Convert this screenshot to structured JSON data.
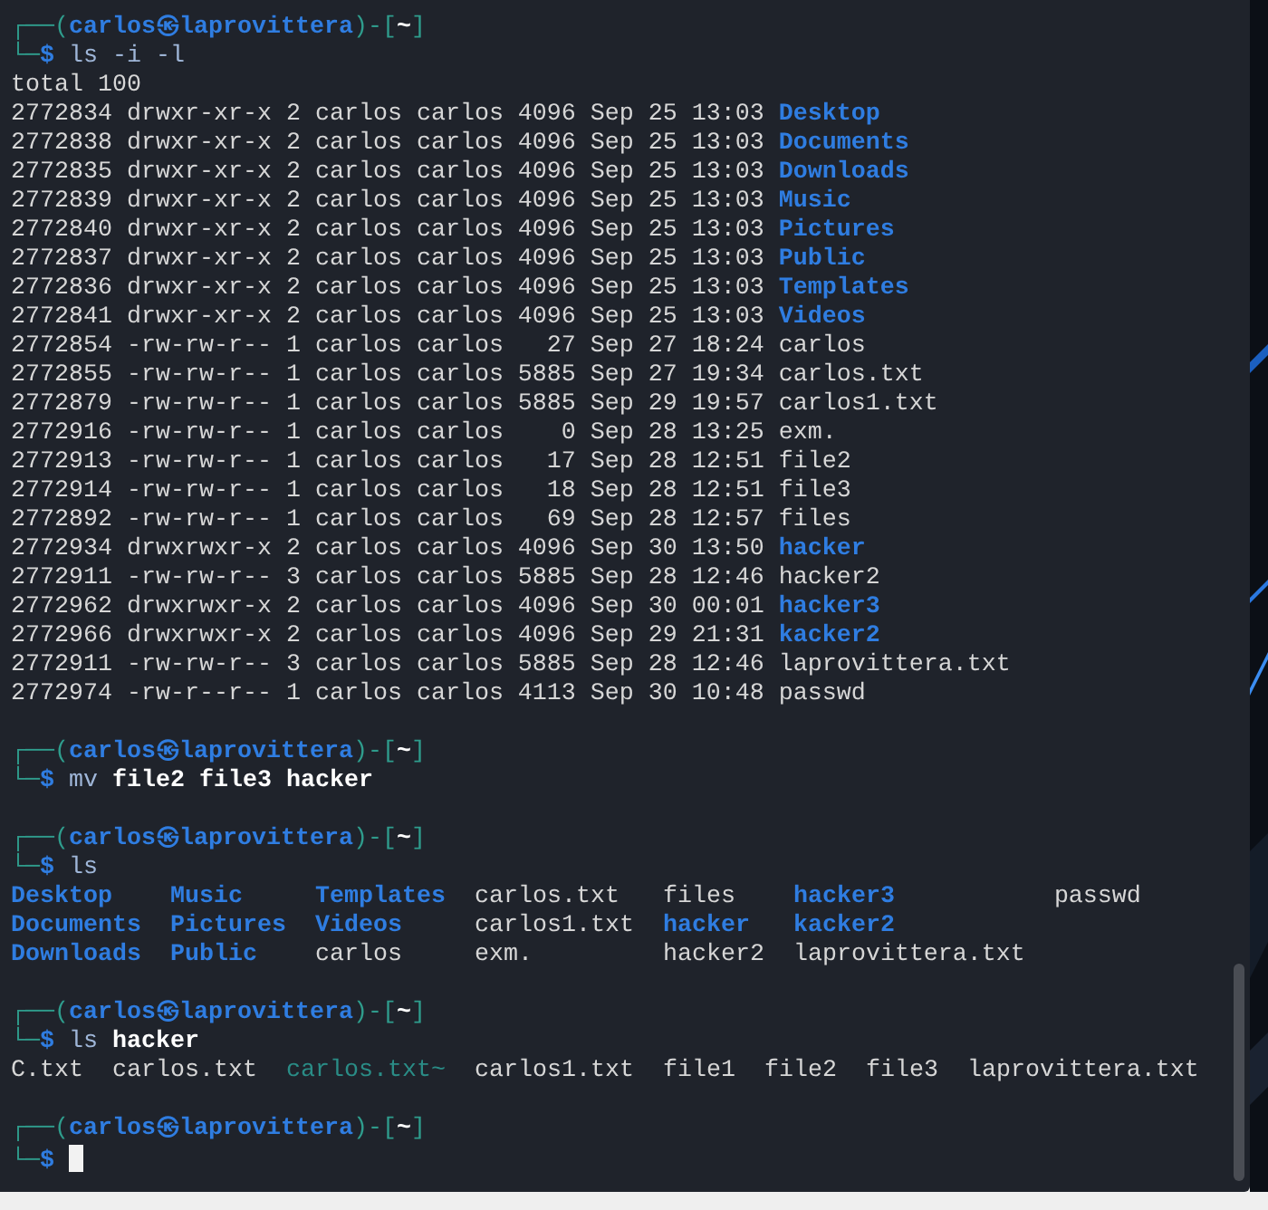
{
  "terminal": {
    "blocks": [
      {
        "prompt": {
          "open": "┌──(",
          "user_host": "carlos㉿laprovittera",
          "mid": ")-[",
          "dir": "~",
          "close": "]",
          "corner": "└─",
          "sign": "$"
        },
        "command": {
          "name": "ls",
          "args": "-i -l",
          "args_bold": false
        },
        "output": {
          "kind": "long_listing",
          "header": "total 100",
          "rows": [
            {
              "inode": "2772834",
              "perms": "drwxr-xr-x",
              "links": "2",
              "owner": "carlos",
              "group": "carlos",
              "size": "4096",
              "date": "Sep 25",
              "time": "13:03",
              "name": "Desktop",
              "kind": "dir"
            },
            {
              "inode": "2772838",
              "perms": "drwxr-xr-x",
              "links": "2",
              "owner": "carlos",
              "group": "carlos",
              "size": "4096",
              "date": "Sep 25",
              "time": "13:03",
              "name": "Documents",
              "kind": "dir"
            },
            {
              "inode": "2772835",
              "perms": "drwxr-xr-x",
              "links": "2",
              "owner": "carlos",
              "group": "carlos",
              "size": "4096",
              "date": "Sep 25",
              "time": "13:03",
              "name": "Downloads",
              "kind": "dir"
            },
            {
              "inode": "2772839",
              "perms": "drwxr-xr-x",
              "links": "2",
              "owner": "carlos",
              "group": "carlos",
              "size": "4096",
              "date": "Sep 25",
              "time": "13:03",
              "name": "Music",
              "kind": "dir"
            },
            {
              "inode": "2772840",
              "perms": "drwxr-xr-x",
              "links": "2",
              "owner": "carlos",
              "group": "carlos",
              "size": "4096",
              "date": "Sep 25",
              "time": "13:03",
              "name": "Pictures",
              "kind": "dir"
            },
            {
              "inode": "2772837",
              "perms": "drwxr-xr-x",
              "links": "2",
              "owner": "carlos",
              "group": "carlos",
              "size": "4096",
              "date": "Sep 25",
              "time": "13:03",
              "name": "Public",
              "kind": "dir"
            },
            {
              "inode": "2772836",
              "perms": "drwxr-xr-x",
              "links": "2",
              "owner": "carlos",
              "group": "carlos",
              "size": "4096",
              "date": "Sep 25",
              "time": "13:03",
              "name": "Templates",
              "kind": "dir"
            },
            {
              "inode": "2772841",
              "perms": "drwxr-xr-x",
              "links": "2",
              "owner": "carlos",
              "group": "carlos",
              "size": "4096",
              "date": "Sep 25",
              "time": "13:03",
              "name": "Videos",
              "kind": "dir"
            },
            {
              "inode": "2772854",
              "perms": "-rw-rw-r--",
              "links": "1",
              "owner": "carlos",
              "group": "carlos",
              "size": "27",
              "date": "Sep 27",
              "time": "18:24",
              "name": "carlos",
              "kind": "file"
            },
            {
              "inode": "2772855",
              "perms": "-rw-rw-r--",
              "links": "1",
              "owner": "carlos",
              "group": "carlos",
              "size": "5885",
              "date": "Sep 27",
              "time": "19:34",
              "name": "carlos.txt",
              "kind": "file"
            },
            {
              "inode": "2772879",
              "perms": "-rw-rw-r--",
              "links": "1",
              "owner": "carlos",
              "group": "carlos",
              "size": "5885",
              "date": "Sep 29",
              "time": "19:57",
              "name": "carlos1.txt",
              "kind": "file"
            },
            {
              "inode": "2772916",
              "perms": "-rw-rw-r--",
              "links": "1",
              "owner": "carlos",
              "group": "carlos",
              "size": "0",
              "date": "Sep 28",
              "time": "13:25",
              "name": "exm.",
              "kind": "file"
            },
            {
              "inode": "2772913",
              "perms": "-rw-rw-r--",
              "links": "1",
              "owner": "carlos",
              "group": "carlos",
              "size": "17",
              "date": "Sep 28",
              "time": "12:51",
              "name": "file2",
              "kind": "file"
            },
            {
              "inode": "2772914",
              "perms": "-rw-rw-r--",
              "links": "1",
              "owner": "carlos",
              "group": "carlos",
              "size": "18",
              "date": "Sep 28",
              "time": "12:51",
              "name": "file3",
              "kind": "file"
            },
            {
              "inode": "2772892",
              "perms": "-rw-rw-r--",
              "links": "1",
              "owner": "carlos",
              "group": "carlos",
              "size": "69",
              "date": "Sep 28",
              "time": "12:57",
              "name": "files",
              "kind": "file"
            },
            {
              "inode": "2772934",
              "perms": "drwxrwxr-x",
              "links": "2",
              "owner": "carlos",
              "group": "carlos",
              "size": "4096",
              "date": "Sep 30",
              "time": "13:50",
              "name": "hacker",
              "kind": "dir"
            },
            {
              "inode": "2772911",
              "perms": "-rw-rw-r--",
              "links": "3",
              "owner": "carlos",
              "group": "carlos",
              "size": "5885",
              "date": "Sep 28",
              "time": "12:46",
              "name": "hacker2",
              "kind": "file"
            },
            {
              "inode": "2772962",
              "perms": "drwxrwxr-x",
              "links": "2",
              "owner": "carlos",
              "group": "carlos",
              "size": "4096",
              "date": "Sep 30",
              "time": "00:01",
              "name": "hacker3",
              "kind": "dir"
            },
            {
              "inode": "2772966",
              "perms": "drwxrwxr-x",
              "links": "2",
              "owner": "carlos",
              "group": "carlos",
              "size": "4096",
              "date": "Sep 29",
              "time": "21:31",
              "name": "kacker2",
              "kind": "dir"
            },
            {
              "inode": "2772911",
              "perms": "-rw-rw-r--",
              "links": "3",
              "owner": "carlos",
              "group": "carlos",
              "size": "5885",
              "date": "Sep 28",
              "time": "12:46",
              "name": "laprovittera.txt",
              "kind": "file"
            },
            {
              "inode": "2772974",
              "perms": "-rw-r--r--",
              "links": "1",
              "owner": "carlos",
              "group": "carlos",
              "size": "4113",
              "date": "Sep 30",
              "time": "10:48",
              "name": "passwd",
              "kind": "file"
            }
          ]
        }
      },
      {
        "prompt": {
          "open": "┌──(",
          "user_host": "carlos㉿laprovittera",
          "mid": ")-[",
          "dir": "~",
          "close": "]",
          "corner": "└─",
          "sign": "$"
        },
        "command": {
          "name": "mv",
          "args": "file2 file3 hacker",
          "args_bold": true
        }
      },
      {
        "prompt": {
          "open": "┌──(",
          "user_host": "carlos㉿laprovittera",
          "mid": ")-[",
          "dir": "~",
          "close": "]",
          "corner": "└─",
          "sign": "$"
        },
        "command": {
          "name": "ls"
        },
        "output": {
          "kind": "columns",
          "columns": [
            [
              {
                "name": "Desktop",
                "kind": "dir"
              },
              {
                "name": "Documents",
                "kind": "dir"
              },
              {
                "name": "Downloads",
                "kind": "dir"
              }
            ],
            [
              {
                "name": "Music",
                "kind": "dir"
              },
              {
                "name": "Pictures",
                "kind": "dir"
              },
              {
                "name": "Public",
                "kind": "dir"
              }
            ],
            [
              {
                "name": "Templates",
                "kind": "dir"
              },
              {
                "name": "Videos",
                "kind": "dir"
              },
              {
                "name": "carlos",
                "kind": "file"
              }
            ],
            [
              {
                "name": "carlos.txt",
                "kind": "file"
              },
              {
                "name": "carlos1.txt",
                "kind": "file"
              },
              {
                "name": "exm.",
                "kind": "file"
              }
            ],
            [
              {
                "name": "files",
                "kind": "file"
              },
              {
                "name": "hacker",
                "kind": "dir"
              },
              {
                "name": "hacker2",
                "kind": "file"
              }
            ],
            [
              {
                "name": "hacker3",
                "kind": "dir"
              },
              {
                "name": "kacker2",
                "kind": "dir"
              },
              {
                "name": "laprovittera.txt",
                "kind": "file"
              }
            ],
            [
              {
                "name": "passwd",
                "kind": "file"
              }
            ]
          ]
        }
      },
      {
        "prompt": {
          "open": "┌──(",
          "user_host": "carlos㉿laprovittera",
          "mid": ")-[",
          "dir": "~",
          "close": "]",
          "corner": "└─",
          "sign": "$"
        },
        "command": {
          "name": "ls",
          "args": "hacker",
          "args_bold": true
        },
        "output": {
          "kind": "inline",
          "items": [
            {
              "name": "C.txt",
              "kind": "file"
            },
            {
              "name": "carlos.txt",
              "kind": "file"
            },
            {
              "name": "carlos.txt~",
              "kind": "backup"
            },
            {
              "name": "carlos1.txt",
              "kind": "file"
            },
            {
              "name": "file1",
              "kind": "file"
            },
            {
              "name": "file2",
              "kind": "file"
            },
            {
              "name": "file3",
              "kind": "file"
            },
            {
              "name": "laprovittera.txt",
              "kind": "file"
            }
          ]
        }
      },
      {
        "prompt": {
          "open": "┌──(",
          "user_host": "carlos㉿laprovittera",
          "mid": ")-[",
          "dir": "~",
          "close": "]",
          "corner": "└─",
          "sign": "$"
        },
        "cursor": true
      }
    ]
  }
}
